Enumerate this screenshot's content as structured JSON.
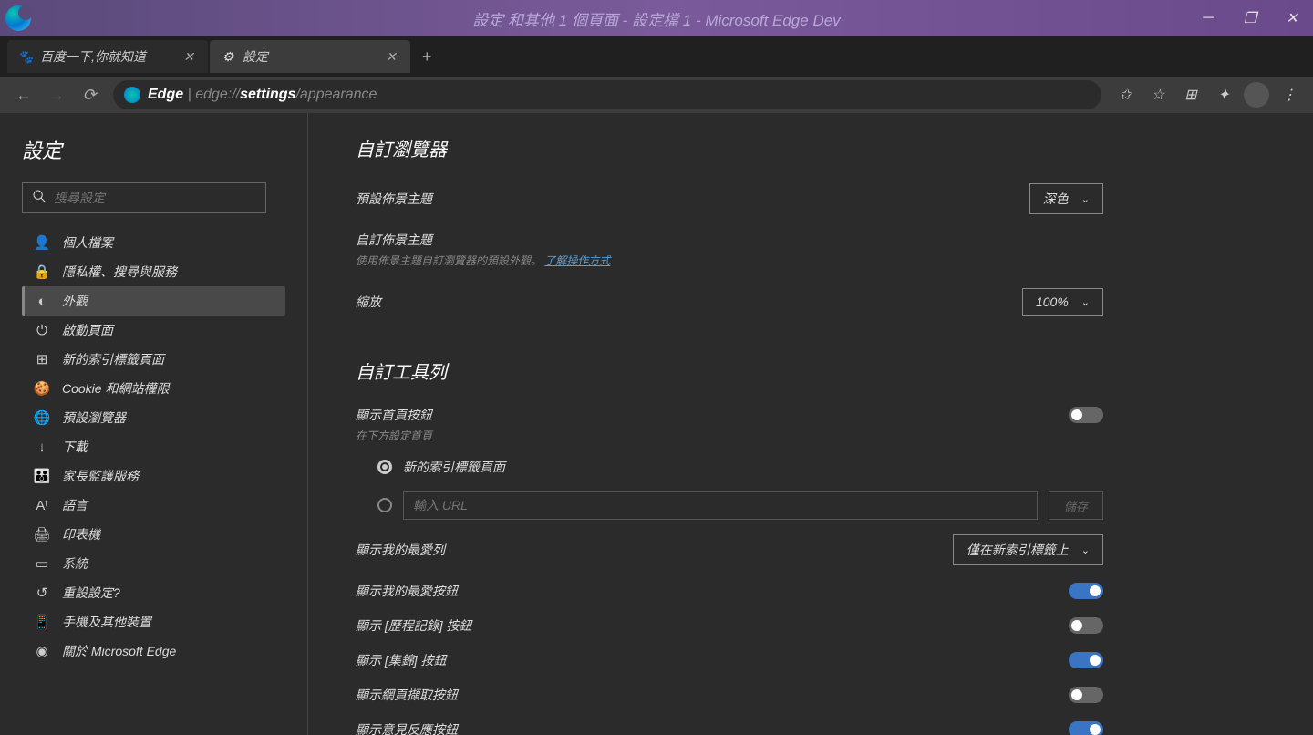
{
  "window": {
    "title": "設定 和其他 1 個頁面 - 設定檔 1 - Microsoft Edge Dev"
  },
  "tabs": [
    {
      "title": "百度一下,你就知道"
    },
    {
      "title": "設定"
    }
  ],
  "address": {
    "label": "Edge",
    "prefix": "edge://",
    "path": "settings",
    "suffix": "/appearance"
  },
  "sidebar": {
    "title": "設定",
    "search_placeholder": "搜尋設定",
    "items": [
      {
        "label": "個人檔案"
      },
      {
        "label": "隱私權、搜尋與服務"
      },
      {
        "label": "外觀"
      },
      {
        "label": "啟動頁面"
      },
      {
        "label": "新的索引標籤頁面"
      },
      {
        "label": "Cookie 和網站權限"
      },
      {
        "label": "預設瀏覽器"
      },
      {
        "label": "下載"
      },
      {
        "label": "家長監護服務"
      },
      {
        "label": "語言"
      },
      {
        "label": "印表機"
      },
      {
        "label": "系統"
      },
      {
        "label": "重設設定?"
      },
      {
        "label": "手機及其他裝置"
      },
      {
        "label": "關於 Microsoft Edge"
      }
    ]
  },
  "main": {
    "section1_title": "自訂瀏覽器",
    "theme_label": "預設佈景主題",
    "theme_value": "深色",
    "custom_theme_label": "自訂佈景主題",
    "custom_theme_sub": "使用佈景主題自訂瀏覽器的預設外觀。",
    "custom_theme_link": "了解操作方式",
    "zoom_label": "縮放",
    "zoom_value": "100%",
    "section2_title": "自訂工具列",
    "home_btn_label": "顯示首頁按鈕",
    "home_btn_sub": "在下方設定首頁",
    "radio_newtab": "新的索引標籤頁面",
    "url_placeholder": "輸入 URL",
    "save_label": "儲存",
    "fav_bar_label": "顯示我的最愛列",
    "fav_bar_value": "僅在新索引標籤上",
    "fav_btn_label": "顯示我的最愛按鈕",
    "history_btn_label": "顯示 [歷程記錄] 按鈕",
    "collections_btn_label": "顯示 [集錦] 按鈕",
    "capture_btn_label": "顯示網頁擷取按鈕",
    "feedback_btn_label": "顯示意見反應按鈕"
  }
}
